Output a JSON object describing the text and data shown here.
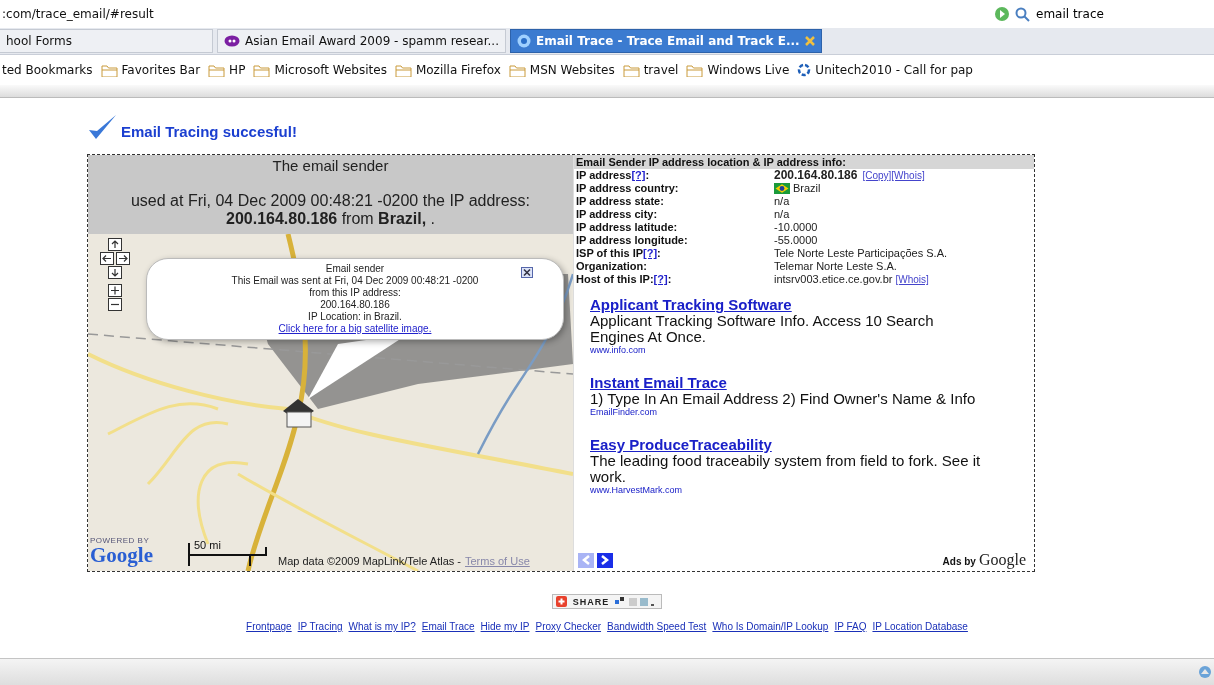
{
  "browser": {
    "address": ":com/trace_email/#result",
    "search": "email trace",
    "tabs": [
      {
        "label": "hool Forms",
        "selected": false,
        "kind": "plain"
      },
      {
        "label": "Asian Email Award 2009 - spamm resear...",
        "selected": false,
        "kind": "yahoo"
      },
      {
        "label": "Email Trace - Trace Email and Track E...",
        "selected": true,
        "kind": "site"
      }
    ],
    "bookmarks": [
      {
        "label": "ted Bookmarks",
        "kind": "plain"
      },
      {
        "label": "Favorites Bar",
        "kind": "folder"
      },
      {
        "label": "HP",
        "kind": "folder"
      },
      {
        "label": "Microsoft Websites",
        "kind": "folder"
      },
      {
        "label": "Mozilla Firefox",
        "kind": "folder"
      },
      {
        "label": "MSN Websites",
        "kind": "folder"
      },
      {
        "label": "travel",
        "kind": "folder"
      },
      {
        "label": "Windows Live",
        "kind": "folder"
      },
      {
        "label": "Unitech2010 - Call for pap",
        "kind": "site"
      }
    ]
  },
  "page": {
    "heading": "Email Tracing succesful!",
    "sender_panel": {
      "title": "The email sender",
      "summary": "used at Fri, 04 Dec 2009 00:48:21 -0200 the IP address: **200.164.80.186** from **Brazil,** ."
    },
    "map": {
      "bubble": {
        "title": "Email sender",
        "lines": [
          "This Email was sent at Fri, 04 Dec 2009 00:48:21 -0200",
          "from this IP address:",
          "200.164.80.186",
          "IP Location: in Brazil."
        ],
        "link": "Click here for a big satellite image."
      },
      "powered_by": "POWERED BY",
      "logo": "Google",
      "scale": "50 mi",
      "attribution": "Map data ©2009 MapLink/Tele Atlas -",
      "terms": "Terms of Use"
    },
    "info": {
      "title": "Email Sender IP address location & IP address info:",
      "rows": [
        {
          "label": "IP address",
          "help": "[?]",
          "tail": ":",
          "value": "200.164.80.186",
          "kind": "ip",
          "links": [
            "[Copy]",
            "[Whois]"
          ]
        },
        {
          "label": "IP address country:",
          "value": "Brazil",
          "kind": "flag"
        },
        {
          "label": "IP address state:",
          "value": "n/a",
          "kind": "text"
        },
        {
          "label": "IP address city:",
          "value": "n/a",
          "kind": "text"
        },
        {
          "label": "IP address latitude:",
          "value": "-10.0000",
          "kind": "text"
        },
        {
          "label": "IP address longitude:",
          "value": "-55.0000",
          "kind": "text"
        },
        {
          "label": "ISP of this IP",
          "help": "[?]",
          "tail": ":",
          "value": "Tele Norte Leste Participações S.A.",
          "kind": "text"
        },
        {
          "label": "Organization:",
          "value": "Telemar Norte Leste S.A.",
          "kind": "text"
        },
        {
          "label": "Host of this IP:",
          "help": "[?]",
          "tail": ":",
          "value": "intsrv003.etice.ce.gov.br",
          "kind": "text",
          "links": [
            "[Whois]"
          ]
        }
      ]
    },
    "ads": [
      {
        "title": "Applicant Tracking Software",
        "text": "Applicant Tracking Software Info. Access 10 Search Engines At Once.",
        "url": "www.info.com"
      },
      {
        "title": "Instant Email Trace",
        "text": "1) Type In An Email Address 2) Find Owner's Name & Info",
        "url": "EmailFinder.com"
      },
      {
        "title": "Easy ProduceTraceability",
        "text": "The leading food traceabily system from field to fork. See it work.",
        "url": "www.HarvestMark.com"
      }
    ],
    "ads_pager": {
      "prev_disabled": true,
      "next_disabled": false
    },
    "ads_by": "Ads by",
    "ads_logo": "Google",
    "share": "SHARE",
    "footer_links": [
      "Frontpage",
      "IP Tracing",
      "What is my IP?",
      "Email Trace",
      "Hide my IP",
      "Proxy Checker",
      "Bandwidth Speed Test",
      "Who Is Domain/IP Lookup",
      "IP FAQ",
      "IP Location Database"
    ]
  }
}
